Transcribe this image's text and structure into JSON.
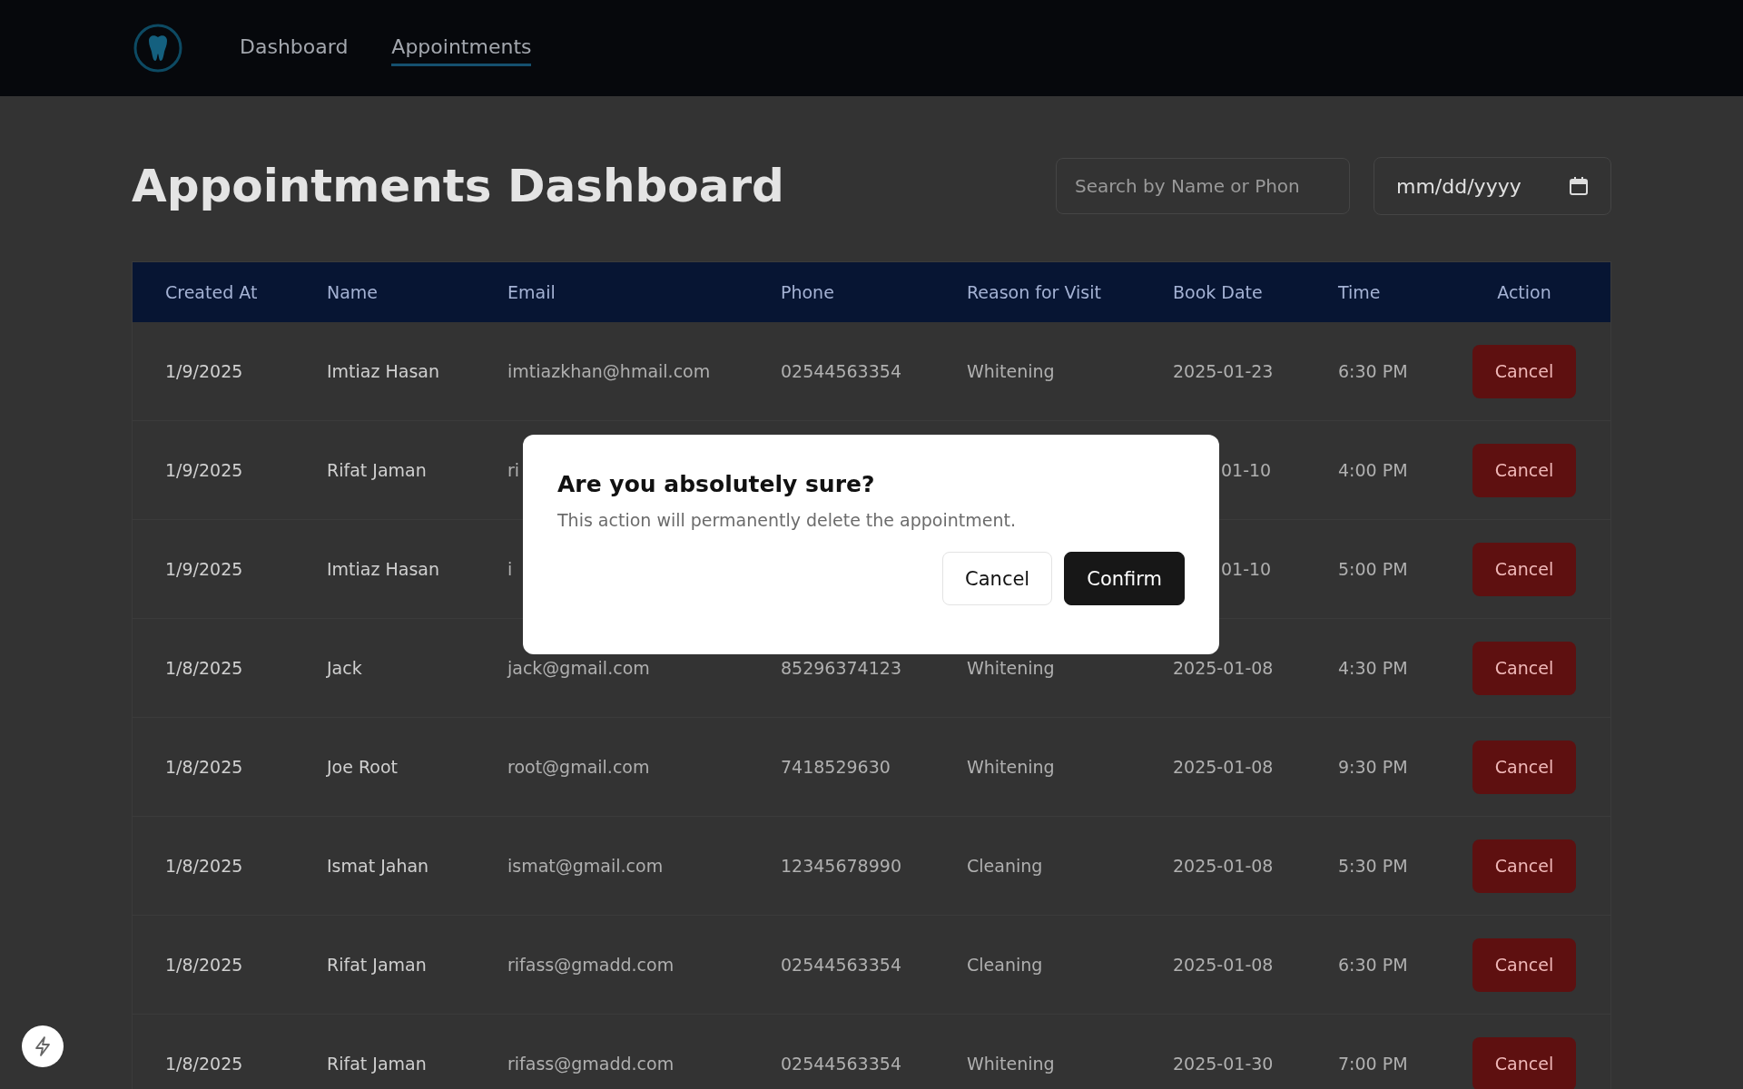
{
  "nav": {
    "items": [
      {
        "label": "Dashboard",
        "selected": false
      },
      {
        "label": "Appointments",
        "selected": true
      }
    ]
  },
  "page_title": "Appointments Dashboard",
  "search": {
    "placeholder": "Search by Name or Phon"
  },
  "date_filter": {
    "value": "mm/dd/yyyy"
  },
  "table": {
    "columns": [
      "Created At",
      "Name",
      "Email",
      "Phone",
      "Reason for Visit",
      "Book Date",
      "Time",
      "Action"
    ],
    "rows": [
      {
        "created_at": "1/9/2025",
        "name": "Imtiaz Hasan",
        "email": "imtiazkhan@hmail.com",
        "phone": "02544563354",
        "reason": "Whitening",
        "book_date": "2025-01-23",
        "time": "6:30 PM",
        "action": "Cancel"
      },
      {
        "created_at": "1/9/2025",
        "name": "Rifat Jaman",
        "email": "ri",
        "book_date": "01-10",
        "book_date_cut_start": true,
        "time": "4:00 PM",
        "action": "Cancel"
      },
      {
        "created_at": "1/9/2025",
        "name": "Imtiaz Hasan",
        "email": "i",
        "book_date": "01-10",
        "book_date_cut_start": true,
        "time": "5:00 PM",
        "action": "Cancel"
      },
      {
        "created_at": "1/8/2025",
        "name": "Jack",
        "email": "jack@gmail.com",
        "phone": "85296374123",
        "reason": "Whitening",
        "book_date": "2025-01-08",
        "time": "4:30 PM",
        "action": "Cancel"
      },
      {
        "created_at": "1/8/2025",
        "name": "Joe Root",
        "email": "root@gmail.com",
        "phone": "7418529630",
        "reason": "Whitening",
        "book_date": "2025-01-08",
        "time": "9:30 PM",
        "action": "Cancel"
      },
      {
        "created_at": "1/8/2025",
        "name": "Ismat Jahan",
        "email": "ismat@gmail.com",
        "phone": "12345678990",
        "reason": "Cleaning",
        "book_date": "2025-01-08",
        "time": "5:30 PM",
        "action": "Cancel"
      },
      {
        "created_at": "1/8/2025",
        "name": "Rifat Jaman",
        "email": "rifass@gmadd.com",
        "phone": "02544563354",
        "reason": "Cleaning",
        "book_date": "2025-01-08",
        "time": "6:30 PM",
        "action": "Cancel"
      },
      {
        "created_at": "1/8/2025",
        "name": "Rifat Jaman",
        "email": "rifass@gmadd.com",
        "phone": "02544563354",
        "reason": "Whitening",
        "book_date": "2025-01-30",
        "time": "7:00 PM",
        "action": "Cancel"
      }
    ]
  },
  "dialog": {
    "title": "Are you absolutely sure?",
    "message": "This action will permanently delete the appointment.",
    "buttons": [
      {
        "label": "Cancel",
        "kind": "secondary"
      },
      {
        "label": "Confirm",
        "kind": "primary"
      }
    ]
  }
}
